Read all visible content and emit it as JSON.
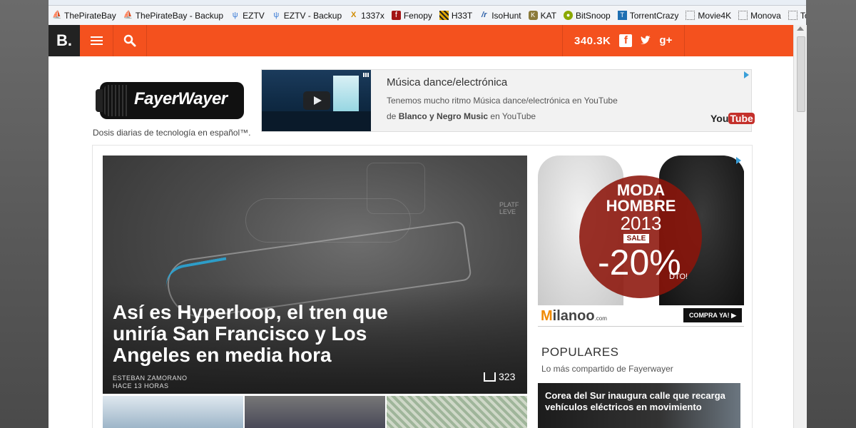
{
  "bookmarks": [
    {
      "label": "ThePirateBay",
      "icon": "pirate-ship-icon"
    },
    {
      "label": "ThePirateBay - Backup",
      "icon": "pirate-ship-icon"
    },
    {
      "label": "EZTV",
      "icon": "eztv-icon"
    },
    {
      "label": "EZTV - Backup",
      "icon": "eztv-icon"
    },
    {
      "label": "1337x",
      "icon": "1337x-icon"
    },
    {
      "label": "Fenopy",
      "icon": "fenopy-icon"
    },
    {
      "label": "H33T",
      "icon": "h33t-icon"
    },
    {
      "label": "IsoHunt",
      "icon": "isohunt-icon"
    },
    {
      "label": "KAT",
      "icon": "kat-icon"
    },
    {
      "label": "BitSnoop",
      "icon": "bitsnoop-icon"
    },
    {
      "label": "TorrentCrazy",
      "icon": "torrentcrazy-icon"
    },
    {
      "label": "Movie4K",
      "icon": "blank-page-icon"
    },
    {
      "label": "Monova",
      "icon": "blank-page-icon"
    },
    {
      "label": "Torrentz",
      "icon": "blank-page-icon"
    }
  ],
  "topbar": {
    "logo": "B.",
    "share_count": "340.3K",
    "accent": "#f4511e"
  },
  "header": {
    "logo_text": "FayerWayer",
    "tagline": "Dosis diarias de tecnología en español™."
  },
  "yt_ad": {
    "title": "Música dance/electrónica",
    "description": "Tenemos mucho ritmo Música dance/electrónica en YouTube",
    "by_prefix": "de",
    "channel": "Blanco y Negro Music",
    "by_suffix": "en YouTube",
    "logo_you": "You",
    "logo_tube": "Tube"
  },
  "featured": {
    "headline": "Así es Hyperloop, el tren que uniría San Francisco y Los Angeles en media hora",
    "author": "ESTEBAN ZAMORANO",
    "time": "HACE 13 HORAS",
    "shares": "323",
    "sketch_note": "PLATF LEVE"
  },
  "banner_ad": {
    "line1": "MODA",
    "line2": "HOMBRE",
    "line3": "2013",
    "sale": "SALE",
    "discount": "-20%",
    "dto": "DTO!",
    "brand_m": "M",
    "brand_rest": "ilanoo",
    "brand_com": ".com",
    "cta": "COMPRA YA! ▶"
  },
  "populares": {
    "title": "POPULARES",
    "subtitle": "Lo más compartido de Fayerwayer",
    "items": [
      {
        "title": "Corea del Sur inaugura calle que recarga vehículos eléctricos en movimiento"
      }
    ]
  }
}
